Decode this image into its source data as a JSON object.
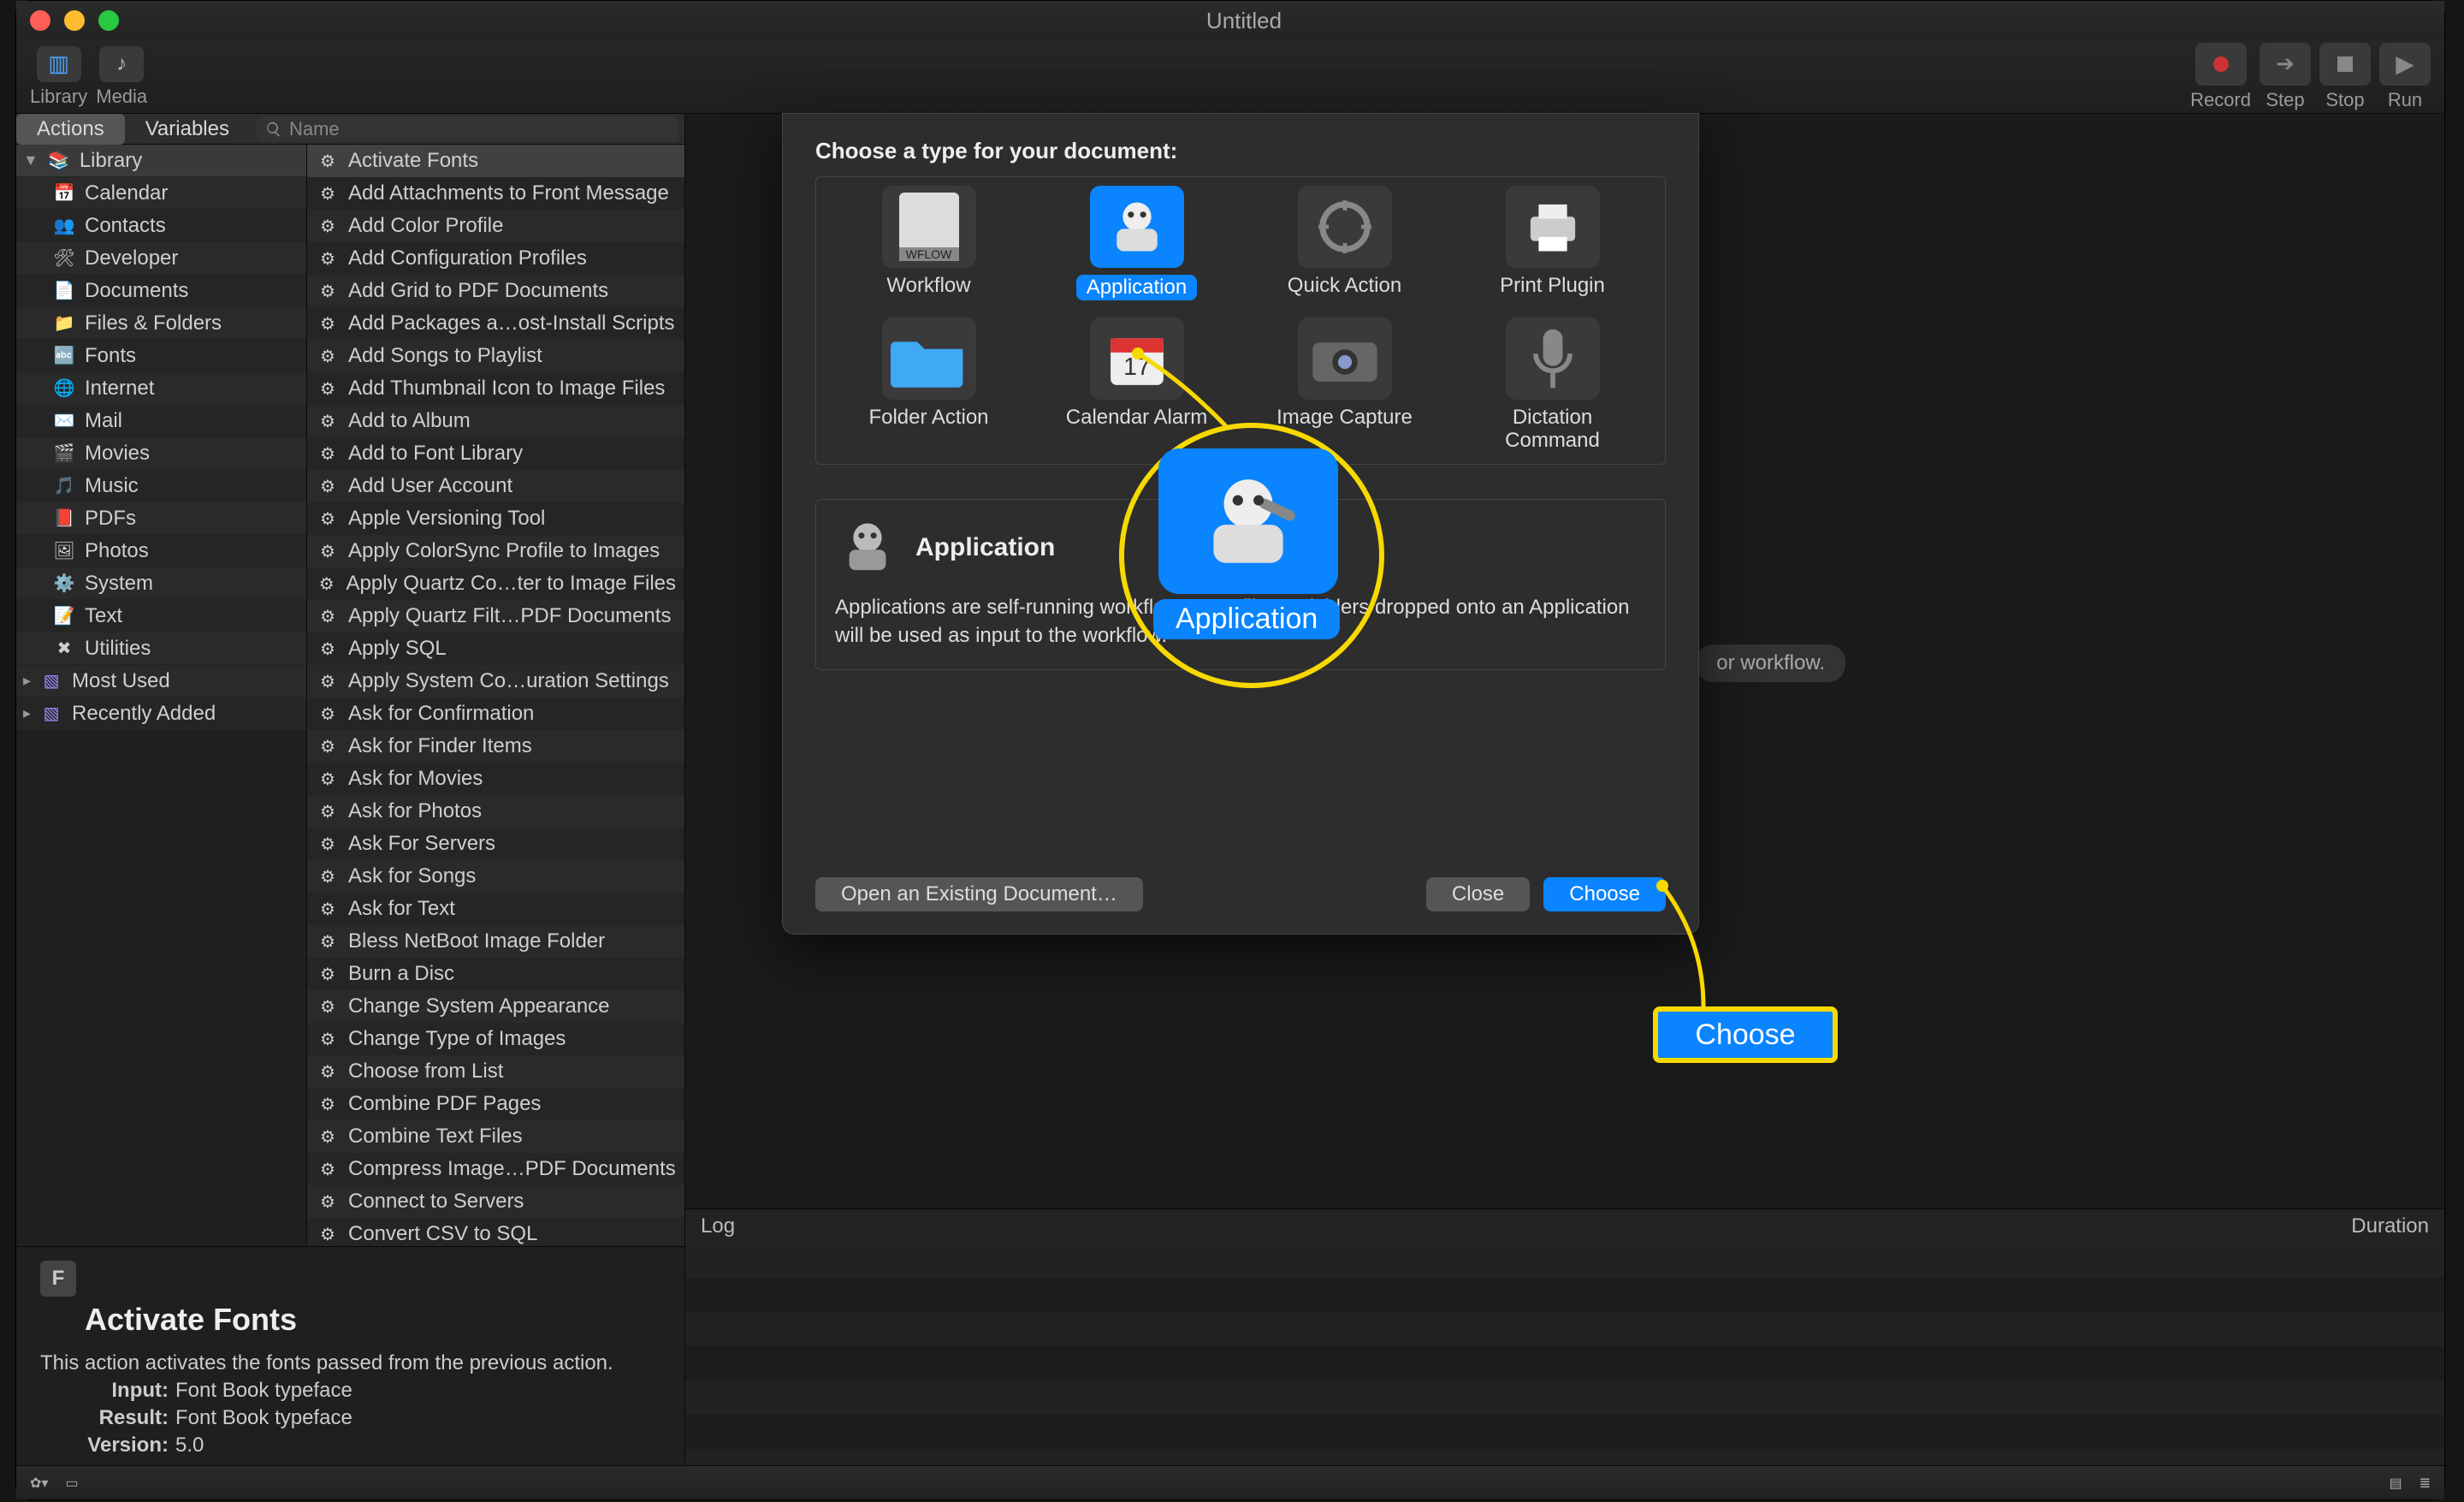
{
  "window_title": "Untitled",
  "toolbar_left": [
    {
      "name": "library-toggle",
      "label": "Library"
    },
    {
      "name": "media-toggle",
      "label": "Media"
    }
  ],
  "toolbar_right": [
    {
      "name": "record-button",
      "label": "Record"
    },
    {
      "name": "step-button",
      "label": "Step"
    },
    {
      "name": "stop-button",
      "label": "Stop"
    },
    {
      "name": "run-button",
      "label": "Run"
    }
  ],
  "tabs": {
    "actions": "Actions",
    "variables": "Variables"
  },
  "search_placeholder": "Name",
  "library": {
    "header": "Library",
    "items": [
      {
        "label": "Calendar"
      },
      {
        "label": "Contacts"
      },
      {
        "label": "Developer"
      },
      {
        "label": "Documents"
      },
      {
        "label": "Files & Folders"
      },
      {
        "label": "Fonts"
      },
      {
        "label": "Internet"
      },
      {
        "label": "Mail"
      },
      {
        "label": "Movies"
      },
      {
        "label": "Music"
      },
      {
        "label": "PDFs"
      },
      {
        "label": "Photos"
      },
      {
        "label": "System"
      },
      {
        "label": "Text"
      },
      {
        "label": "Utilities"
      }
    ],
    "extras": [
      {
        "label": "Most Used"
      },
      {
        "label": "Recently Added"
      }
    ]
  },
  "actions": [
    "Activate Fonts",
    "Add Attachments to Front Message",
    "Add Color Profile",
    "Add Configuration Profiles",
    "Add Grid to PDF Documents",
    "Add Packages a…ost-Install Scripts",
    "Add Songs to Playlist",
    "Add Thumbnail Icon to Image Files",
    "Add to Album",
    "Add to Font Library",
    "Add User Account",
    "Apple Versioning Tool",
    "Apply ColorSync Profile to Images",
    "Apply Quartz Co…ter to Image Files",
    "Apply Quartz Filt…PDF Documents",
    "Apply SQL",
    "Apply System Co…uration Settings",
    "Ask for Confirmation",
    "Ask for Finder Items",
    "Ask for Movies",
    "Ask for Photos",
    "Ask For Servers",
    "Ask for Songs",
    "Ask for Text",
    "Bless NetBoot Image Folder",
    "Burn a Disc",
    "Change System Appearance",
    "Change Type of Images",
    "Choose from List",
    "Combine PDF Pages",
    "Combine Text Files",
    "Compress Image…PDF Documents",
    "Connect to Servers",
    "Convert CSV to SQL"
  ],
  "desc_pane": {
    "title": "Activate Fonts",
    "body": "This action activates the fonts passed from the previous action.",
    "input_label": "Input:",
    "input_val": "Font Book typeface",
    "result_label": "Result:",
    "result_val": "Font Book typeface",
    "version_label": "Version:",
    "version_val": "5.0"
  },
  "log": {
    "left": "Log",
    "right": "Duration"
  },
  "wf_hint": "or workflow.",
  "sheet": {
    "prompt": "Choose a type for your document:",
    "types": [
      {
        "name": "workflow",
        "label": "Workflow"
      },
      {
        "name": "application",
        "label": "Application",
        "selected": true
      },
      {
        "name": "quick-action",
        "label": "Quick Action"
      },
      {
        "name": "print-plugin",
        "label": "Print Plugin"
      },
      {
        "name": "folder-action",
        "label": "Folder Action"
      },
      {
        "name": "calendar-alarm",
        "label": "Calendar Alarm"
      },
      {
        "name": "image-capture",
        "label": "Image Capture"
      },
      {
        "name": "dictation-command",
        "label": "Dictation\nCommand"
      }
    ],
    "desc_title": "Application",
    "desc_body": "Applications are self-running workflows. Any files or folders dropped onto an Application will be used as input to the workflow.",
    "btn_open": "Open an Existing Document…",
    "btn_close": "Close",
    "btn_choose": "Choose"
  },
  "callout": {
    "circle_label": "Application",
    "box_label": "Choose"
  }
}
